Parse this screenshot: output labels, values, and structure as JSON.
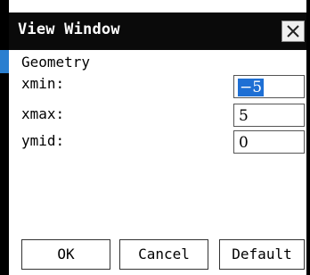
{
  "dialog": {
    "title": "View Window",
    "close_icon": "close-icon"
  },
  "form": {
    "section_label": "Geometry",
    "fields": [
      {
        "label": "xmin:",
        "value": "−5",
        "selected": true
      },
      {
        "label": "xmax:",
        "value": "5",
        "selected": false
      },
      {
        "label": "ymid:",
        "value": "0",
        "selected": false
      }
    ]
  },
  "buttons": {
    "ok": "OK",
    "cancel": "Cancel",
    "default": "Default"
  },
  "colors": {
    "titlebar": "#0a0a0a",
    "accent": "#2a7fd0",
    "selection": "#1e6fd4"
  }
}
